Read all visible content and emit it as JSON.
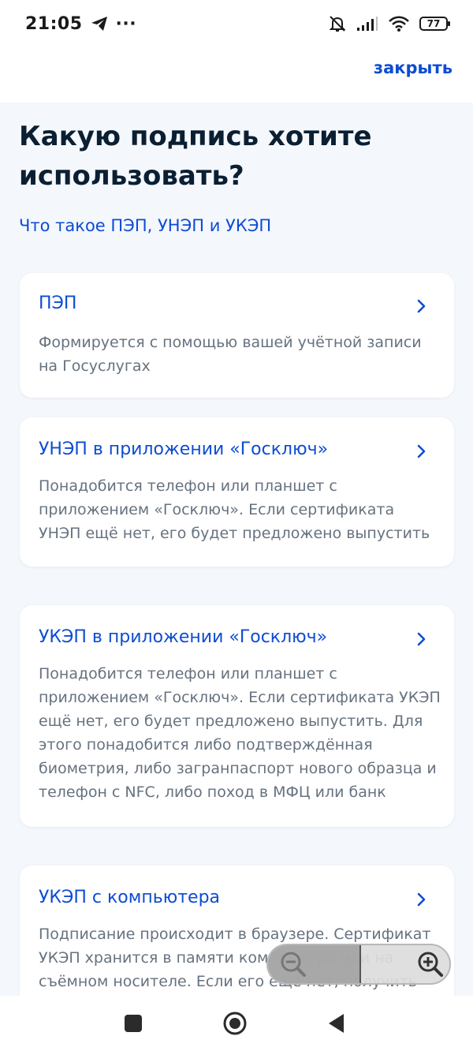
{
  "status_bar": {
    "time": "21:05",
    "more": "···",
    "battery": "77"
  },
  "header": {
    "close_label": "закрыть"
  },
  "main": {
    "title": "Какую подпись хотите использовать?",
    "info_link": "Что такое ПЭП, УНЭП и УКЭП"
  },
  "cards": [
    {
      "title": "ПЭП",
      "description": "Формируется с помощью вашей учётной записи на Госуслугах"
    },
    {
      "title": "УНЭП в приложении «Госключ»",
      "description": "Понадобится телефон или планшет с приложением «Госключ». Если сертификата УНЭП ещё нет, его будет предложено выпустить"
    },
    {
      "title": "УКЭП в приложении «Госключ»",
      "description": "Понадобится телефон или планшет с приложением «Госключ». Если сертификата УКЭП ещё нет, его будет предложено выпустить. Для этого понадобится либо подтверждённая биометрия, либо загранпаспорт нового образца и телефон с NFC, либо поход в МФЦ или банк"
    },
    {
      "title": "УКЭП с компьютера",
      "description": "Подписание происходит в браузере. Сертификат УКЭП хранится в памяти компьютера или на съёмном носителе. Если его ещё нет, получить"
    }
  ],
  "colors": {
    "accent": "#0d4cd3",
    "text_primary": "#0b1f33",
    "text_secondary": "#66727f",
    "background": "#f4f7fc"
  },
  "icons": {
    "telegram": "telegram-icon",
    "mute": "muted-bell-icon",
    "signal": "signal-icon",
    "wifi": "wifi-icon",
    "chevron": "chevron-right-icon",
    "zoom_out": "zoom-out-icon",
    "zoom_in": "zoom-in-icon",
    "nav_recents": "square-icon",
    "nav_home": "circle-icon",
    "nav_back": "back-triangle-icon"
  }
}
